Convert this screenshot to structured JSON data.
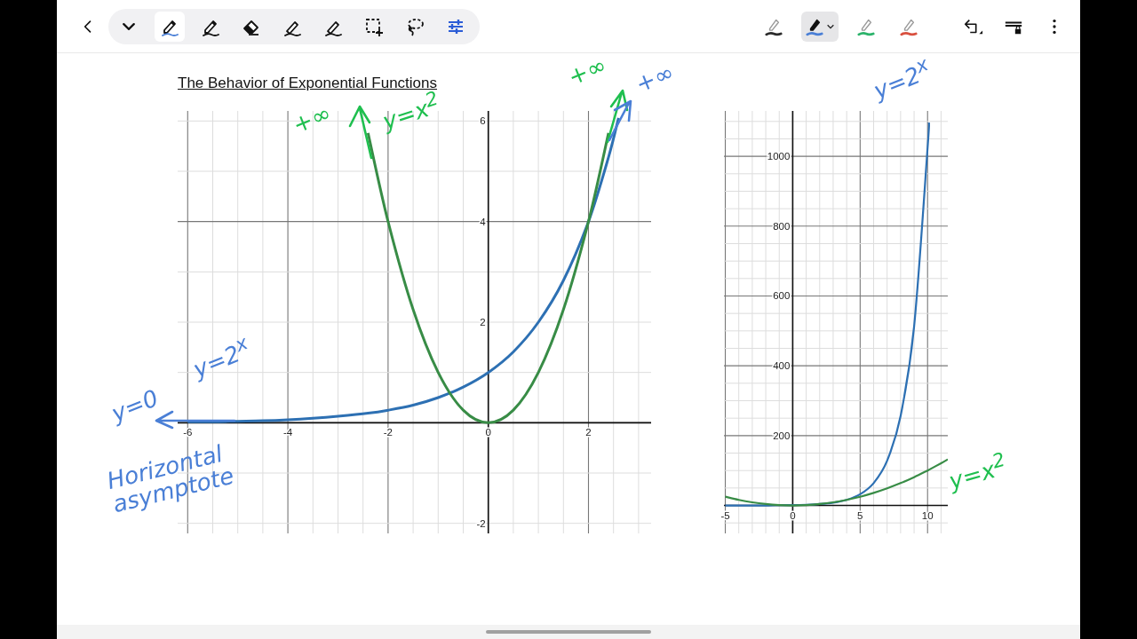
{
  "toolbar": {
    "tools": [
      {
        "kind": "chevron",
        "selected": false
      },
      {
        "kind": "pen",
        "selected": true
      },
      {
        "kind": "pen",
        "selected": false
      },
      {
        "kind": "eraser",
        "selected": false
      },
      {
        "kind": "highlighter",
        "selected": false
      },
      {
        "kind": "highlighter",
        "selected": false
      },
      {
        "kind": "select",
        "selected": false
      },
      {
        "kind": "lasso",
        "selected": false
      },
      {
        "kind": "adjust",
        "selected": false
      }
    ],
    "pen_presets": [
      {
        "color": "#2b2b2b",
        "selected": false
      },
      {
        "color": "#4a7fd6",
        "selected": true
      },
      {
        "color": "#2bb36a",
        "selected": false
      },
      {
        "color": "#d9503f",
        "selected": false
      }
    ]
  },
  "page": {
    "title": "The Behavior of Exponential Functions",
    "charts": [
      {
        "chart_data": {
          "type": "line",
          "grid": true,
          "x": [
            -6,
            -5.5,
            -5,
            -4.5,
            -4,
            -3.5,
            -3,
            -2.4,
            -2,
            -1.5,
            -1,
            -0.5,
            0,
            0.5,
            1,
            1.5,
            2,
            2.4,
            2.6
          ],
          "xlim": [
            -6.2,
            3.25
          ],
          "ylim": [
            -2.2,
            6.2
          ],
          "xticks": [
            -6,
            -4,
            -2,
            0,
            2
          ],
          "yticks": [
            -2,
            2,
            4,
            6
          ],
          "series": [
            {
              "color": "#2d70b3",
              "values": [
                0.02,
                0.02,
                0.03,
                0.04,
                0.06,
                0.09,
                0.13,
                0.19,
                0.25,
                0.35,
                0.5,
                0.71,
                1,
                1.41,
                2,
                2.83,
                4,
                5.28,
                6.06
              ]
            },
            {
              "color": "#388c46",
              "values": [
                null,
                null,
                null,
                null,
                null,
                null,
                null,
                5.76,
                4,
                2.25,
                1,
                0.25,
                0,
                0.25,
                1,
                2.25,
                4,
                5.76,
                null
              ]
            }
          ]
        }
      },
      {
        "chart_data": {
          "type": "line",
          "grid": true,
          "x": [
            -5,
            -4,
            -3,
            -2,
            -1,
            0,
            1,
            2,
            3,
            4,
            5,
            6,
            7,
            8,
            9,
            10,
            10.1,
            11,
            11.5
          ],
          "xlim": [
            -5.1,
            11.5
          ],
          "ylim": [
            -80,
            1130
          ],
          "xticks": [
            -5,
            0,
            5,
            10
          ],
          "yticks": [
            200,
            400,
            600,
            800,
            1000
          ],
          "series": [
            {
              "color": "#2d70b3",
              "values": [
                0,
                0,
                0,
                0,
                1,
                1,
                2,
                4,
                8,
                16,
                32,
                64,
                128,
                256,
                512,
                1024,
                1097,
                null,
                null
              ]
            },
            {
              "color": "#388c46",
              "values": [
                25,
                16,
                9,
                4,
                1,
                0,
                1,
                4,
                9,
                16,
                25,
                36,
                49,
                64,
                81,
                100,
                102,
                121,
                132
              ]
            }
          ]
        }
      }
    ],
    "annotations": [
      {
        "text": "+∞",
        "color": "#1fbf4f"
      },
      {
        "text": "y=x$^{2}$",
        "color": "#1fbf4f"
      },
      {
        "text": "+∞",
        "color": "#1fbf4f"
      },
      {
        "text": "+∞",
        "color": "#4a7fd6"
      },
      {
        "text": "y=2$^{x}$",
        "color": "#4a7fd6"
      },
      {
        "text": "y=2$^{x}$",
        "color": "#4a7fd6"
      },
      {
        "text": "y=0",
        "color": "#4a7fd6"
      },
      {
        "text": "Horizontal asymptote",
        "color": "#4a7fd6"
      },
      {
        "text": "y=x$^{2}$",
        "color": "#1fbf4f"
      }
    ],
    "ink_arrows": [
      {
        "color": "#1fbf4f"
      },
      {
        "color": "#1fbf4f"
      },
      {
        "color": "#4a7fd6"
      },
      {
        "color": "#4a7fd6"
      }
    ]
  }
}
